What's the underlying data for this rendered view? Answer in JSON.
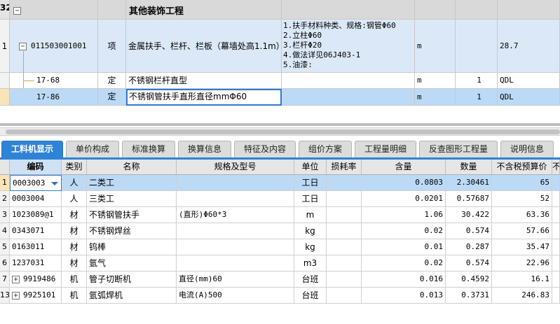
{
  "upper": {
    "section": {
      "index": "32",
      "title": "其他装饰工程"
    },
    "rows": [
      {
        "index": "1",
        "code": "011503001001",
        "type": "项",
        "name": "金属扶手、栏杆、栏板（幕墙处高1.1m）",
        "spec": [
          "1.扶手材料种类、规格:钢管Φ60",
          "2.立柱Φ60",
          "3.栏杆Φ20",
          "4.做法详见06J403-1",
          "5.油漆:"
        ],
        "unit": "m",
        "qty": "",
        "qty2": "28.7"
      },
      {
        "index": "",
        "code": "17-68",
        "type": "定",
        "name": "不锈钢栏杆直型",
        "spec": [],
        "unit": "m",
        "qty": "1",
        "qty2": "QDL"
      },
      {
        "index": "",
        "code": "17-86",
        "type": "定",
        "name": "不锈钢管扶手直形直径mmΦ60",
        "spec": [],
        "unit": "m",
        "qty": "1",
        "qty2": "QDL"
      }
    ]
  },
  "tabs": [
    "工料机显示",
    "单价构成",
    "标准换算",
    "换算信息",
    "特征及内容",
    "组价方案",
    "工程量明细",
    "反查图形工程量",
    "说明信息"
  ],
  "lower": {
    "headers": [
      "编码",
      "类别",
      "名称",
      "规格及型号",
      "单位",
      "损耗率",
      "含量",
      "数量",
      "不含税预算价",
      "不"
    ],
    "rows": [
      {
        "idx": "1",
        "code": "0003003",
        "cat": "人",
        "name": "二类工",
        "spec": "",
        "unit": "工日",
        "loss": "",
        "content": "0.0803",
        "qty": "2.30461",
        "price": "65",
        "expand": false
      },
      {
        "idx": "2",
        "code": "0003004",
        "cat": "人",
        "name": "三类工",
        "spec": "",
        "unit": "工日",
        "loss": "",
        "content": "0.0201",
        "qty": "0.57687",
        "price": "52",
        "expand": false
      },
      {
        "idx": "3",
        "code": "1023089@1",
        "cat": "材",
        "name": "不锈钢管扶手",
        "spec": "(直形)Φ60*3",
        "unit": "m",
        "loss": "",
        "content": "1.06",
        "qty": "30.422",
        "price": "63.36",
        "expand": false
      },
      {
        "idx": "4",
        "code": "0343071",
        "cat": "材",
        "name": "不锈钢焊丝",
        "spec": "",
        "unit": "kg",
        "loss": "",
        "content": "0.02",
        "qty": "0.574",
        "price": "57.66",
        "expand": false
      },
      {
        "idx": "5",
        "code": "0163011",
        "cat": "材",
        "name": "钨棒",
        "spec": "",
        "unit": "kg",
        "loss": "",
        "content": "0.01",
        "qty": "0.287",
        "price": "35.47",
        "expand": false
      },
      {
        "idx": "6",
        "code": "1237031",
        "cat": "材",
        "name": "氩气",
        "spec": "",
        "unit": "m3",
        "loss": "",
        "content": "0.02",
        "qty": "0.574",
        "price": "22.96",
        "expand": false
      },
      {
        "idx": "7",
        "code": "9919486",
        "cat": "机",
        "name": "管子切断机",
        "spec": "直径(mm)60",
        "unit": "台班",
        "loss": "",
        "content": "0.016",
        "qty": "0.4592",
        "price": "16.1",
        "expand": true
      },
      {
        "idx": "13",
        "code": "9925101",
        "cat": "机",
        "name": "氩弧焊机",
        "spec": "电流(A)500",
        "unit": "台班",
        "loss": "",
        "content": "0.013",
        "qty": "0.3731",
        "price": "246.83",
        "expand": true
      }
    ]
  },
  "icons": {
    "collapse": "minus-box-icon",
    "expand": "plus-box-icon",
    "dropdown": "dropdown-arrow-icon"
  },
  "colors": {
    "tab_active": "#2f83d6",
    "row_selected": "#bcdaf6",
    "section_bg": "#d9d9d9",
    "row_blue": "#dbe8f7"
  }
}
